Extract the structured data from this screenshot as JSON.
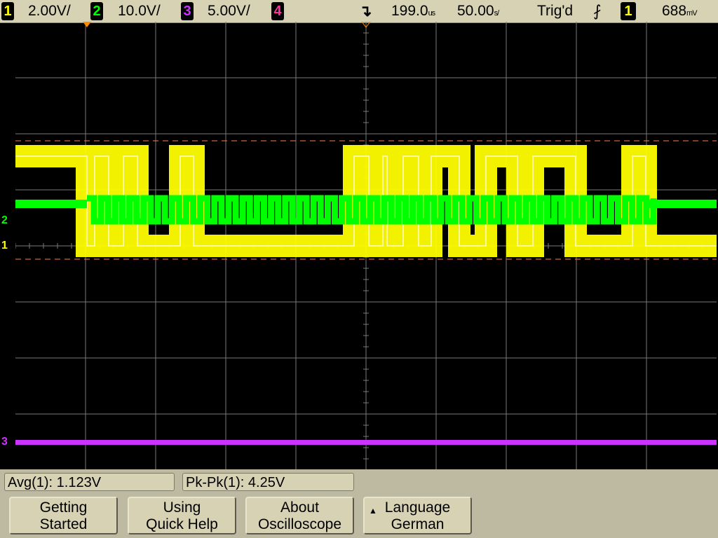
{
  "status_bar": {
    "ch1_num": "1",
    "ch1_scale": "2.00V/",
    "ch2_num": "2",
    "ch2_scale": "10.0V/",
    "ch3_num": "3",
    "ch3_scale": "5.00V/",
    "ch4_num": "4",
    "time_delay": "199.0",
    "time_delay_unit": "us",
    "time_scale": "50.00",
    "time_scale_unit": "s/",
    "trig_status": "Trig'd",
    "trig_source": "1",
    "trig_level": "688",
    "trig_level_unit": "mV"
  },
  "markers": {
    "ch1": "1",
    "ch2": "2",
    "ch3": "3"
  },
  "measurements": {
    "avg": "Avg(1): 1.123V",
    "pkpk": "Pk-Pk(1): 4.25V"
  },
  "softkeys": [
    {
      "line1": "Getting",
      "line2": "Started"
    },
    {
      "line1": "Using",
      "line2": "Quick Help"
    },
    {
      "line1": "About",
      "line2": "Oscilloscope"
    },
    {
      "line1": "Language",
      "line2": "German"
    }
  ],
  "colors": {
    "ch1": "#ffff00",
    "ch2": "#00ff00",
    "ch3": "#cc33ff",
    "ch4": "#ff3399",
    "grid": "#7a7a7a",
    "cursor": "#ff8040"
  },
  "traces": {
    "ch1_transitions": [
      0,
      102,
      113,
      133,
      154,
      174,
      235,
      254,
      483,
      504,
      524,
      530,
      553,
      575,
      593,
      633,
      671,
      716,
      738,
      799,
      880,
      899,
      1000
    ],
    "ch2_period": 20.2,
    "ch2_active_range": [
      102,
      899
    ]
  }
}
